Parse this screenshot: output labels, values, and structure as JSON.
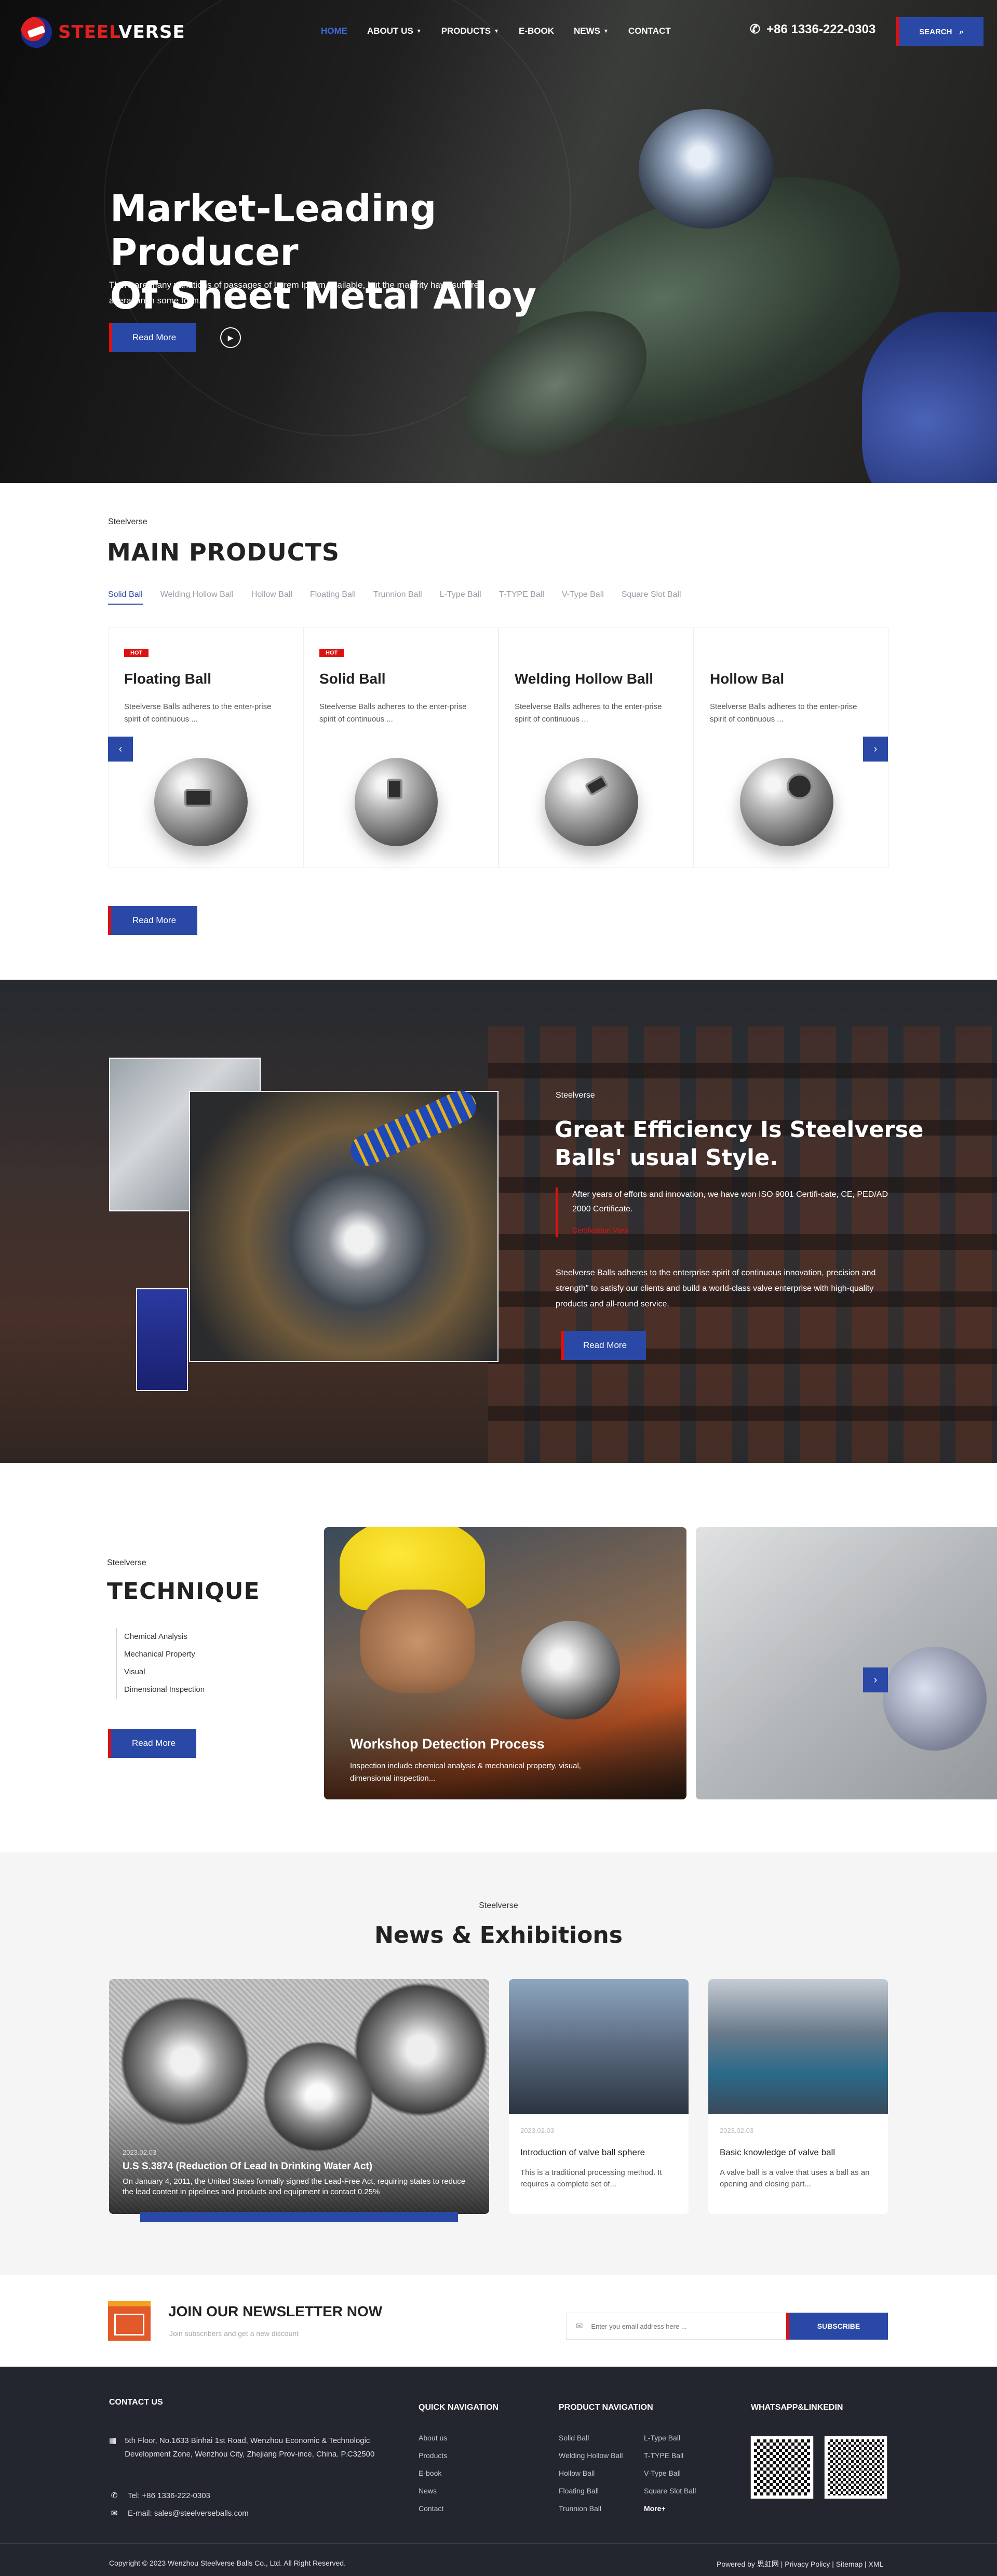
{
  "header": {
    "logo": {
      "part1": "STEEL",
      "part2": "VERSE"
    },
    "nav": [
      {
        "label": "HOME",
        "active": true,
        "dropdown": false
      },
      {
        "label": "ABOUT US",
        "active": false,
        "dropdown": true
      },
      {
        "label": "PRODUCTS",
        "active": false,
        "dropdown": true
      },
      {
        "label": "E-BOOK",
        "active": false,
        "dropdown": false
      },
      {
        "label": "NEWS",
        "active": false,
        "dropdown": true
      },
      {
        "label": "CONTACT",
        "active": false,
        "dropdown": false
      }
    ],
    "phone": "+86 1336-222-0303",
    "search_label": "SEARCH"
  },
  "hero": {
    "title_line1": "Market-Leading Producer",
    "title_line2": "Of Sheet Metal Alloy",
    "text": "There are many variations of passages of Lorem Ipsum available, but the majority have suffered alteration in some form.",
    "button": "Read More"
  },
  "products": {
    "kicker": "Steelverse",
    "title": "MAIN PRODUCTS",
    "tabs": [
      "Solid Ball",
      "Welding Hollow Ball",
      "Hollow Ball",
      "Floating Ball",
      "Trunnion Ball",
      "L-Type Ball",
      "T-TYPE Ball",
      "V-Type Ball",
      "Square Slot Ball"
    ],
    "active_tab": 0,
    "cards": [
      {
        "badge": "HOT",
        "name": "Floating Ball",
        "desc": "Steelverse Balls adheres to the enter-prise spirit of continuous ..."
      },
      {
        "badge": "HOT",
        "name": "Solid Ball",
        "desc": "Steelverse Balls adheres to the enter-prise spirit of continuous ..."
      },
      {
        "badge": "",
        "name": "Welding Hollow Ball",
        "desc": "Steelverse Balls adheres to the enter-prise spirit of continuous ..."
      },
      {
        "badge": "",
        "name": "Hollow Bal",
        "desc": "Steelverse Balls adheres to the enter-prise spirit of continuous ..."
      }
    ],
    "button": "Read More"
  },
  "efficiency": {
    "kicker": "Steelverse",
    "title": "Great Efficiency Is Steelverse Balls' usual Style.",
    "cert_text": "After years of efforts and innovation, we have won ISO 9001 Certifi-cate, CE, PED/AD 2000 Certificate.",
    "cert_link": "Certification View",
    "desc": "Steelverse Balls adheres to the enterprise spirit of continuous innovation, precision and strength\" to satisfy our clients and build a world-class valve enterprise with high-quality products and all-round service.",
    "button": "Read More"
  },
  "technique": {
    "kicker": "Steelverse",
    "title": "TECHNIQUE",
    "items": [
      "Chemical Analysis",
      "Mechanical Property",
      "Visual",
      "Dimensional Inspection"
    ],
    "button": "Read More",
    "card": {
      "title": "Workshop Detection Process",
      "text": "Inspection include chemical analysis & mechanical property, visual, dimensional inspection..."
    }
  },
  "news": {
    "kicker": "Steelverse",
    "title": "News & Exhibitions",
    "featured": {
      "date": "2023.02.03",
      "title": "U.S S.3874 (Reduction Of Lead In Drinking Water Act)",
      "text": "On January 4, 2011, the United States formally signed the Lead-Free Act, requiring states to reduce the lead content in pipelines and products and equipment in contact 0.25%"
    },
    "items": [
      {
        "date": "2023.02.03",
        "title": "Introduction of valve ball sphere",
        "text": "This is a traditional processing method. It requires a complete set of..."
      },
      {
        "date": "2023.02.03",
        "title": "Basic knowledge of valve ball",
        "text": "A valve ball is a valve that uses a ball as an opening and closing part..."
      }
    ]
  },
  "newsletter": {
    "title": "JOIN OUR NEWSLETTER NOW",
    "subtitle": "Join subscribers and get a new discount",
    "placeholder": "Enter you email address here ...",
    "button": "SUBSCRIBE"
  },
  "footer": {
    "contact_title": "CONTACT US",
    "address": "5th Floor, No.1633 Binhai 1st Road, Wenzhou Economic & Technologic Development Zone, Wenzhou City, Zhejiang Prov-ince, China. P.C32500",
    "tel": "Tel: +86 1336-222-0303",
    "email": "E-mail: sales@steelverseballs.com",
    "quick_title": "QUICK NAVIGATION",
    "quick_links": [
      "About us",
      "Products",
      "E-book",
      "News",
      "Contact"
    ],
    "product_title": "PRODUCT NAVIGATION",
    "product_links_col1": [
      "Solid Ball",
      "Welding Hollow Ball",
      "Hollow Ball",
      "Floating Ball",
      "Trunnion Ball"
    ],
    "product_links_col2": [
      "L-Type Ball",
      "T-TYPE Ball",
      "V-Type Ball",
      "Square Slot Ball",
      "More+"
    ],
    "social_title": "WHATSAPP&LINKEDIN",
    "copyright": "Copyright © 2023 Wenzhou Steelverse Balls Co., Ltd. All Right Reserved.",
    "bottom_links": "Powered by 思虹网 | Privacy Policy | Sitemap | XML"
  },
  "colors": {
    "accent": "#2a48a6",
    "brand_red": "#dd1111",
    "footer_bg": "#23252f"
  }
}
